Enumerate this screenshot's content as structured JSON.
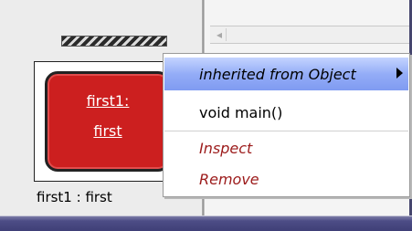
{
  "object": {
    "name_line1": "first1:",
    "name_line2": "first",
    "caption": "first1 : first"
  },
  "context_menu": {
    "items": [
      {
        "label": "inherited from Object",
        "kind": "submenu",
        "selected": true
      },
      {
        "label": "void main()",
        "kind": "method"
      },
      {
        "label": "Inspect",
        "kind": "action"
      },
      {
        "label": "Remove",
        "kind": "action"
      }
    ]
  },
  "colors": {
    "object_fill": "#cc1f1f",
    "menu_highlight": "#94adf7",
    "action_text": "#9c1b1b",
    "frame": "#3f3f77"
  },
  "icons": {
    "submenu_arrow": "triangle-right",
    "scroll_left": "arrow-left"
  }
}
